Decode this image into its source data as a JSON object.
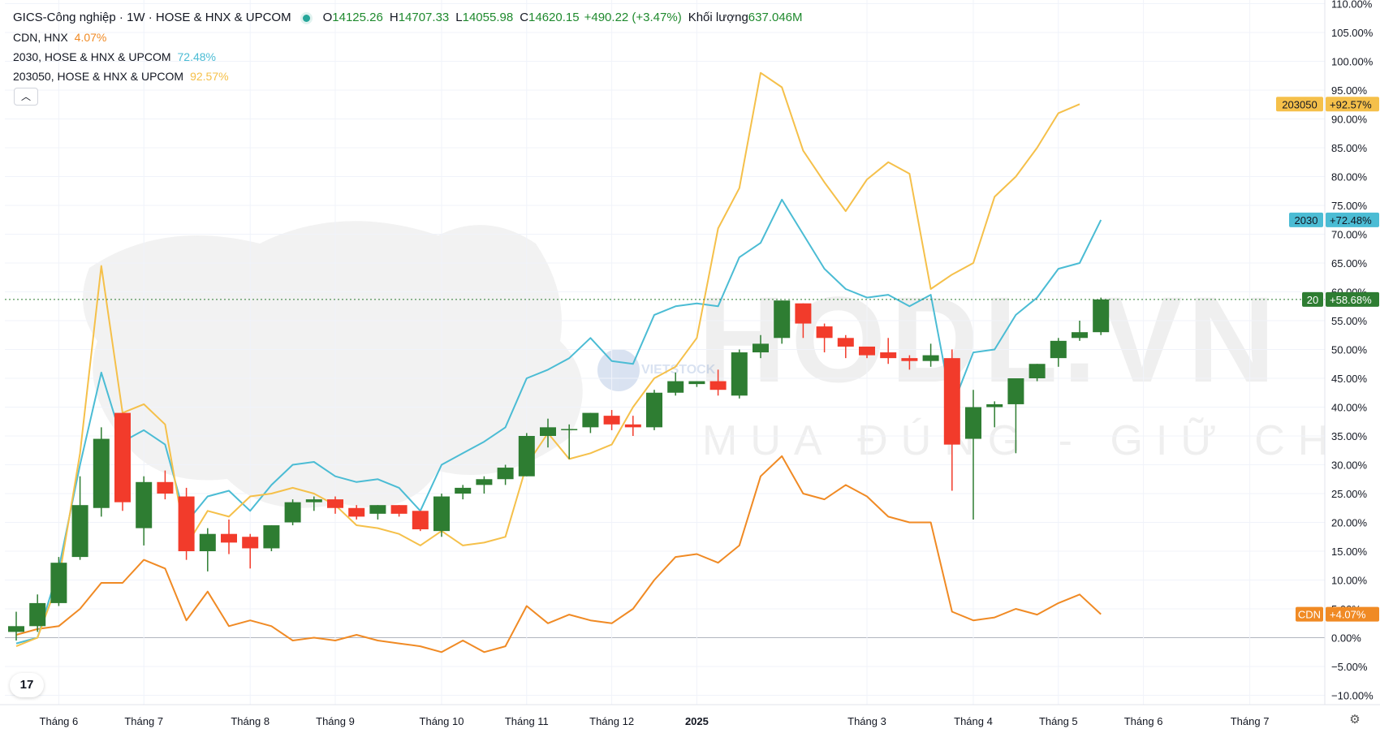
{
  "header": {
    "symbol": "GICS-Công nghiệp · 1W · HOSE & HNX & UPCOM",
    "o_label": "O",
    "o_value": "14125.26",
    "h_label": "H",
    "h_value": "14707.33",
    "l_label": "L",
    "l_value": "14055.98",
    "c_label": "C",
    "c_value": "14620.15",
    "change": "+490.22 (+3.47%)",
    "vol_label": "Khối lượng",
    "vol_value": "637.046M"
  },
  "legend": [
    {
      "name": "CDN, HNX",
      "pct": "4.07%",
      "color": "#f08a24"
    },
    {
      "name": "2030, HOSE & HNX & UPCOM",
      "pct": "72.48%",
      "color": "#4bbcd4"
    },
    {
      "name": "203050, HOSE & HNX & UPCOM",
      "pct": "92.57%",
      "color": "#f5c04a"
    }
  ],
  "watermark": {
    "brand": "HODL.VN",
    "slogan": "MUA ĐÚNG - GIỮ CHẶT",
    "small": "VIETSTOCK"
  },
  "tv_logo": "17",
  "chart_data": {
    "type": "candlestick+line",
    "y_unit": "%",
    "ylim": [
      -11,
      110
    ],
    "yticks": [
      "110.00%",
      "105.00%",
      "100.00%",
      "95.00%",
      "90.00%",
      "85.00%",
      "80.00%",
      "75.00%",
      "70.00%",
      "65.00%",
      "60.00%",
      "55.00%",
      "50.00%",
      "45.00%",
      "40.00%",
      "35.00%",
      "30.00%",
      "25.00%",
      "20.00%",
      "15.00%",
      "10.00%",
      "5.00%",
      "0.00%",
      "−5.00%",
      "−10.00%"
    ],
    "x_labels": [
      "Tháng 6",
      "Tháng 7",
      "Tháng 8",
      "Tháng 9",
      "Tháng 10",
      "Tháng 11",
      "Tháng 12",
      "2025",
      "Tháng 3",
      "Tháng 4",
      "Tháng 5",
      "Tháng 6",
      "Tháng 7"
    ],
    "x_label_weeks": [
      2,
      6,
      11,
      15,
      20,
      24,
      28,
      32,
      40,
      45,
      49,
      53,
      58
    ],
    "bold_label": "2025",
    "candles": [
      {
        "o": 1.0,
        "h": 4.5,
        "l": -0.5,
        "c": 2.0
      },
      {
        "o": 2.0,
        "h": 7.5,
        "l": 1.0,
        "c": 6.0
      },
      {
        "o": 6.0,
        "h": 14.0,
        "l": 5.5,
        "c": 13.0
      },
      {
        "o": 14.0,
        "h": 28.0,
        "l": 13.5,
        "c": 23.0
      },
      {
        "o": 22.5,
        "h": 36.5,
        "l": 21.0,
        "c": 34.5
      },
      {
        "o": 39.0,
        "h": 38.5,
        "l": 22.0,
        "c": 23.5
      },
      {
        "o": 19.0,
        "h": 28.0,
        "l": 16.0,
        "c": 27.0
      },
      {
        "o": 27.0,
        "h": 29.0,
        "l": 24.0,
        "c": 25.0
      },
      {
        "o": 24.5,
        "h": 26.0,
        "l": 13.5,
        "c": 15.0
      },
      {
        "o": 15.0,
        "h": 19.0,
        "l": 11.5,
        "c": 18.0
      },
      {
        "o": 18.0,
        "h": 20.5,
        "l": 14.5,
        "c": 16.5
      },
      {
        "o": 17.5,
        "h": 18.0,
        "l": 12.0,
        "c": 15.5
      },
      {
        "o": 15.5,
        "h": 19.5,
        "l": 15.0,
        "c": 19.5
      },
      {
        "o": 20.0,
        "h": 24.0,
        "l": 19.5,
        "c": 23.5
      },
      {
        "o": 23.5,
        "h": 24.5,
        "l": 22.0,
        "c": 24.0
      },
      {
        "o": 24.0,
        "h": 24.5,
        "l": 21.5,
        "c": 22.5
      },
      {
        "o": 22.5,
        "h": 23.0,
        "l": 20.5,
        "c": 21.0
      },
      {
        "o": 21.5,
        "h": 23.0,
        "l": 20.5,
        "c": 23.0
      },
      {
        "o": 23.0,
        "h": 23.0,
        "l": 21.0,
        "c": 21.5
      },
      {
        "o": 22.0,
        "h": 22.0,
        "l": 18.5,
        "c": 18.8
      },
      {
        "o": 18.5,
        "h": 25.0,
        "l": 17.5,
        "c": 24.5
      },
      {
        "o": 25.0,
        "h": 26.5,
        "l": 24.0,
        "c": 26.0
      },
      {
        "o": 26.5,
        "h": 28.0,
        "l": 25.0,
        "c": 27.5
      },
      {
        "o": 27.5,
        "h": 30.0,
        "l": 26.5,
        "c": 29.5
      },
      {
        "o": 28.0,
        "h": 35.5,
        "l": 28.0,
        "c": 35.0
      },
      {
        "o": 35.0,
        "h": 38.0,
        "l": 33.0,
        "c": 36.5
      },
      {
        "o": 36.0,
        "h": 37.0,
        "l": 31.0,
        "c": 36.2
      },
      {
        "o": 36.5,
        "h": 39.0,
        "l": 35.5,
        "c": 39.0
      },
      {
        "o": 38.5,
        "h": 39.5,
        "l": 36.0,
        "c": 37.0
      },
      {
        "o": 37.0,
        "h": 38.5,
        "l": 35.0,
        "c": 36.5
      },
      {
        "o": 36.5,
        "h": 43.0,
        "l": 36.0,
        "c": 42.5
      },
      {
        "o": 42.5,
        "h": 46.0,
        "l": 42.0,
        "c": 44.5
      },
      {
        "o": 44.0,
        "h": 44.5,
        "l": 43.5,
        "c": 44.5
      },
      {
        "o": 44.5,
        "h": 46.5,
        "l": 42.0,
        "c": 43.0
      },
      {
        "o": 42.0,
        "h": 50.0,
        "l": 41.5,
        "c": 49.5
      },
      {
        "o": 49.5,
        "h": 52.5,
        "l": 48.5,
        "c": 51.0
      },
      {
        "o": 52.0,
        "h": 58.5,
        "l": 51.0,
        "c": 58.5
      },
      {
        "o": 58.0,
        "h": 58.0,
        "l": 52.0,
        "c": 54.5
      },
      {
        "o": 54.0,
        "h": 54.5,
        "l": 49.5,
        "c": 52.0
      },
      {
        "o": 52.0,
        "h": 52.5,
        "l": 48.5,
        "c": 50.5
      },
      {
        "o": 50.5,
        "h": 50.5,
        "l": 48.5,
        "c": 49.0
      },
      {
        "o": 49.5,
        "h": 52.0,
        "l": 47.5,
        "c": 48.5
      },
      {
        "o": 48.5,
        "h": 49.0,
        "l": 46.5,
        "c": 48.0
      },
      {
        "o": 48.0,
        "h": 51.0,
        "l": 47.0,
        "c": 49.0
      },
      {
        "o": 48.5,
        "h": 50.0,
        "l": 25.5,
        "c": 33.5
      },
      {
        "o": 34.5,
        "h": 43.0,
        "l": 20.5,
        "c": 40.0
      },
      {
        "o": 40.0,
        "h": 41.0,
        "l": 36.5,
        "c": 40.5
      },
      {
        "o": 40.5,
        "h": 45.0,
        "l": 32.0,
        "c": 45.0
      },
      {
        "o": 45.0,
        "h": 47.5,
        "l": 44.5,
        "c": 47.5
      },
      {
        "o": 48.5,
        "h": 52.0,
        "l": 47.0,
        "c": 51.5
      },
      {
        "o": 52.0,
        "h": 55.0,
        "l": 51.5,
        "c": 53.0
      },
      {
        "o": 53.0,
        "h": 59.0,
        "l": 52.5,
        "c": 58.68
      }
    ],
    "series": [
      {
        "name": "CDN, HNX",
        "color": "#f08a24",
        "values": [
          0.5,
          1.5,
          2.0,
          5.0,
          9.5,
          9.5,
          13.5,
          12.0,
          3.0,
          8.0,
          2.0,
          3.0,
          2.0,
          -0.5,
          0.0,
          -0.5,
          0.5,
          -0.5,
          -1.0,
          -1.5,
          -2.5,
          -0.5,
          -2.5,
          -1.5,
          5.5,
          2.5,
          4.0,
          3.0,
          2.5,
          5.0,
          10.0,
          14.0,
          14.5,
          13.0,
          16.0,
          28.0,
          31.5,
          25.0,
          24.0,
          26.5,
          24.5,
          21.0,
          20.0,
          20.0,
          4.5,
          3.0,
          3.5,
          5.0,
          4.0,
          6.0,
          7.5,
          4.07
        ]
      },
      {
        "name": "2030, HOSE & HNX & UPCOM",
        "color": "#4bbcd4",
        "values": [
          -1.0,
          0.0,
          12.0,
          30.0,
          46.0,
          34.0,
          36.0,
          33.5,
          20.0,
          24.5,
          25.5,
          22.0,
          26.5,
          30.0,
          30.5,
          28.0,
          27.0,
          27.5,
          26.0,
          22.0,
          30.0,
          32.0,
          34.0,
          36.5,
          45.0,
          46.5,
          48.5,
          52.0,
          48.0,
          47.5,
          56.0,
          57.5,
          58.0,
          57.5,
          66.0,
          68.5,
          76.0,
          70.0,
          64.0,
          60.5,
          59.0,
          59.5,
          57.5,
          59.5,
          40.0,
          49.5,
          50.0,
          56.0,
          59.0,
          64.0,
          65.0,
          72.48
        ]
      },
      {
        "name": "203050, HOSE & HNX & UPCOM",
        "color": "#f5c04a",
        "values": [
          -1.5,
          0.0,
          10.0,
          32.0,
          64.5,
          39.0,
          40.5,
          37.0,
          16.0,
          22.0,
          21.0,
          24.5,
          25.0,
          26.0,
          25.0,
          23.0,
          19.5,
          19.0,
          18.0,
          16.0,
          18.5,
          16.0,
          16.5,
          17.5,
          30.0,
          35.5,
          31.0,
          32.0,
          33.5,
          40.0,
          45.0,
          47.0,
          52.0,
          71.0,
          78.0,
          98.0,
          95.5,
          84.5,
          79.0,
          74.0,
          79.5,
          82.5,
          80.5,
          60.5,
          63.0,
          65.0,
          76.5,
          80.0,
          85.0,
          91.0,
          92.57
        ]
      }
    ],
    "axis_tags": [
      {
        "label": "203050",
        "value_text": "+92.57%",
        "value": 92.57,
        "color": "#f5c04a",
        "text": "#131722"
      },
      {
        "label": "2030",
        "value_text": "+72.48%",
        "value": 72.48,
        "color": "#4bbcd4",
        "text": "#131722"
      },
      {
        "label": "20",
        "value_text": "+58.68%",
        "value": 58.68,
        "color": "#2e7d32",
        "text": "#ffffff"
      },
      {
        "label": "CDN",
        "value_text": "+4.07%",
        "value": 4.07,
        "color": "#f08a24",
        "text": "#ffffff"
      }
    ],
    "current_value": 58.68,
    "up_color": "#2e7d32",
    "down_color": "#f23b2b"
  }
}
